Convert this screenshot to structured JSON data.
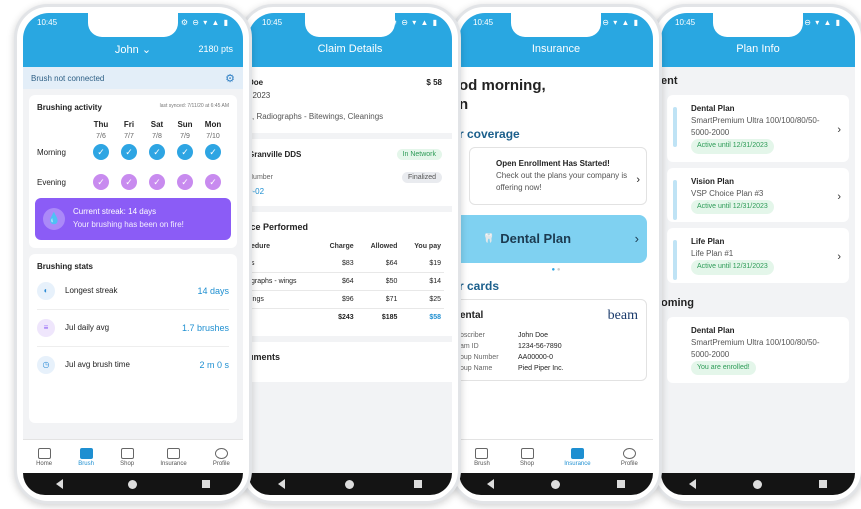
{
  "colors": {
    "brand_blue": "#29a7e1",
    "purple": "#8b5cf6",
    "green": "#2d9b57"
  },
  "phone1": {
    "time": "10:45",
    "status_icons": "⚙ ⊖ ▾ ▲ ▮",
    "title": "John ⌄",
    "points": "2180 pts",
    "connection": "Brush not connected",
    "activity": {
      "title": "Brushing activity",
      "synced": "last synced: 7/11/20 at 6:45 AM",
      "days": [
        {
          "d": "Thu",
          "date": "7/6"
        },
        {
          "d": "Fri",
          "date": "7/7"
        },
        {
          "d": "Sat",
          "date": "7/8"
        },
        {
          "d": "Sun",
          "date": "7/9"
        },
        {
          "d": "Mon",
          "date": "7/10"
        }
      ],
      "morning": "Morning",
      "evening": "Evening"
    },
    "streak": {
      "title": "Current streak: 14 days",
      "subtitle": "Your brushing has been on fire!"
    },
    "stats": {
      "title": "Brushing stats",
      "rows": [
        {
          "label": "Longest streak",
          "value": "14 days"
        },
        {
          "label": "Jul daily avg",
          "value": "1.7 brushes"
        },
        {
          "label": "Jul avg brush time",
          "value": "2 m 0 s"
        }
      ]
    },
    "tabs": [
      "Home",
      "Brush",
      "Shop",
      "Insurance",
      "Profile"
    ]
  },
  "phone2": {
    "time": "10:45",
    "title": "Claim Details",
    "patient": "Doe",
    "date": ", 2023",
    "amount": "$ 58",
    "services": "s, Radiographs - Bitewings, Cleanings",
    "provider": "Granville DDS",
    "network": "In Network",
    "number_label": "Number",
    "claim_number": "0-02",
    "status": "Finalized",
    "section": "ice Performed",
    "table": {
      "headers": [
        "edure",
        "Charge",
        "Allowed",
        "You pay"
      ],
      "rows": [
        [
          "s",
          "$83",
          "$64",
          "$19"
        ],
        [
          "graphs - wings",
          "$64",
          "$50",
          "$14"
        ],
        [
          "ings",
          "$96",
          "$71",
          "$25"
        ]
      ],
      "totals": [
        "",
        "$243",
        "$185",
        "$58"
      ]
    },
    "footer": "uments"
  },
  "phone3": {
    "time": "10:45",
    "title": "Insurance",
    "greeting_1": "od morning,",
    "greeting_2": "n",
    "coverage": "r coverage",
    "enroll_title": "Open Enrollment Has Started!",
    "enroll_body": "Check out the plans your company is offering now!",
    "dental": "Dental Plan",
    "cards": "r cards",
    "card_title": "ental",
    "card_brand": "beam",
    "card_rows": [
      {
        "k": "bscriber",
        "v": "John Doe"
      },
      {
        "k": "am ID",
        "v": "1234-56-7890"
      },
      {
        "k": "oup Number",
        "v": "AA00000-0"
      },
      {
        "k": "oup Name",
        "v": "Pied Piper Inc."
      }
    ],
    "tabs": [
      "Brush",
      "Shop",
      "Insurance",
      "Profile"
    ]
  },
  "phone4": {
    "time": "10:45",
    "title": "Plan Info",
    "current": "ent",
    "plans": [
      {
        "name": "Dental Plan",
        "desc": "SmartPremium Ultra 100/100/80/50-5000-2000",
        "badge": "Active until 12/31/2023"
      },
      {
        "name": "Vision Plan",
        "desc": "VSP Choice Plan #3",
        "badge": "Active until 12/31/2023"
      },
      {
        "name": "Life Plan",
        "desc": "Life Plan #1",
        "badge": "Active until 12/31/2023"
      }
    ],
    "upcoming": "oming",
    "upcoming_plan": {
      "name": "Dental Plan",
      "desc": "SmartPremium Ultra 100/100/80/50-5000-2000",
      "badge": "You are enrolled!"
    }
  }
}
